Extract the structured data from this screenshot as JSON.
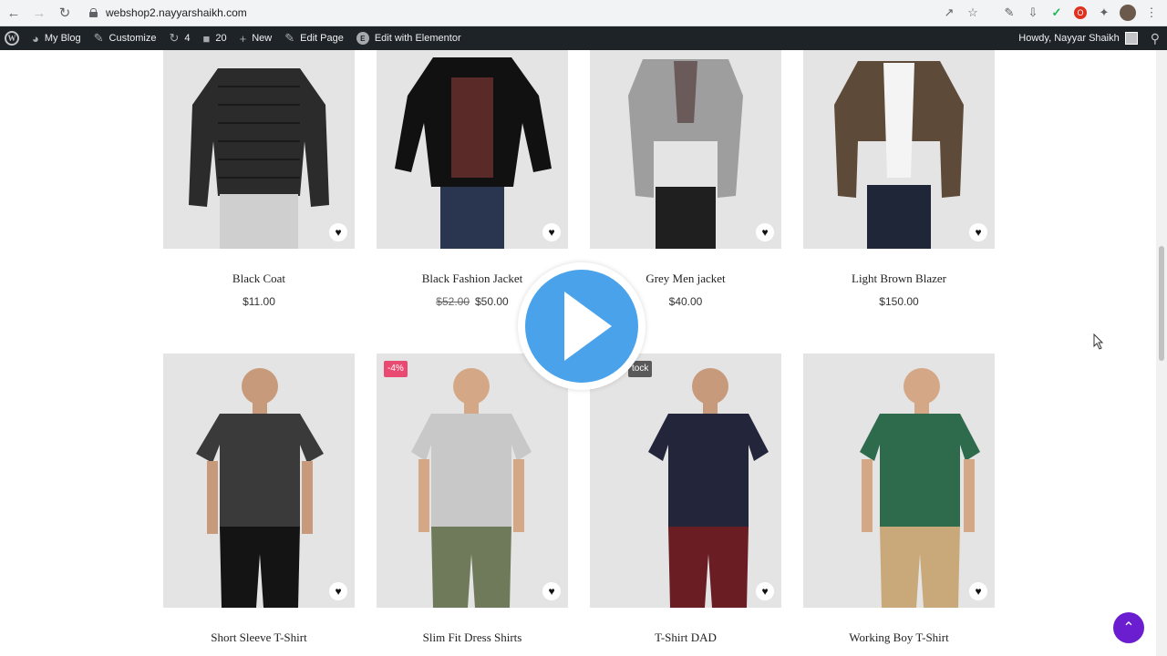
{
  "browser": {
    "url": "webshop2.nayyarshaikh.com",
    "icons": [
      "back-arrow-icon",
      "forward-arrow-icon",
      "reload-icon",
      "lock-icon",
      "share-icon",
      "star-icon",
      "extension-icons",
      "profile-avatar",
      "menu-dots-icon"
    ]
  },
  "admin_bar": {
    "site_name": "My Blog",
    "customize": "Customize",
    "updates": "4",
    "comments": "20",
    "new": "New",
    "edit_page": "Edit Page",
    "elementor": "Edit with Elementor",
    "howdy": "Howdy, Nayyar Shaikh"
  },
  "products": {
    "row1": [
      {
        "name": "Black Coat",
        "price": "$11.00",
        "old_price": ""
      },
      {
        "name": "Black Fashion Jacket",
        "price": "$50.00",
        "old_price": "$52.00"
      },
      {
        "name": "Grey Men jacket",
        "price": "$40.00",
        "old_price": ""
      },
      {
        "name": "Light Brown Blazer",
        "price": "$150.00",
        "old_price": ""
      }
    ],
    "row2": [
      {
        "name": "Short Sleeve T-Shirt",
        "badge": ""
      },
      {
        "name": "Slim Fit Dress Shirts",
        "badge": "-4%"
      },
      {
        "name": "T-Shirt DAD",
        "badge": "tock"
      },
      {
        "name": "Working Boy T-Shirt",
        "badge": ""
      }
    ]
  },
  "colors": {
    "admin_bar_bg": "#1d2327",
    "play_button": "#4aa3ea",
    "sale_badge": "#e94a71",
    "back_to_top": "#6a1ecf"
  }
}
